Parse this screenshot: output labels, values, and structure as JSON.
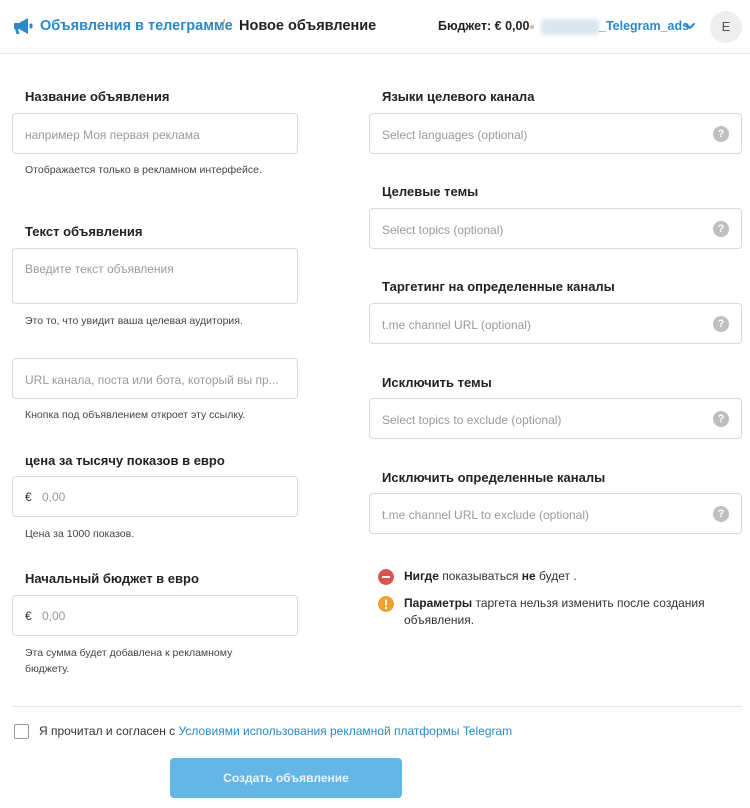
{
  "header": {
    "section_link": "Объявления в телеграмме",
    "separator": "/",
    "current_page": "Новое объявление",
    "budget": "Бюджет: € 0,00",
    "account_name": "_Telegram_ads",
    "avatar_letter": "E",
    "logo_icon": "megaphone-icon",
    "accent_color": "#2b8ac6"
  },
  "left": {
    "ad_name_label": "Название объявления",
    "ad_name_placeholder": "например Моя первая реклама",
    "ad_name_hint": "Отображается только в рекламном интерфейсе.",
    "ad_text_label": "Текст объявления",
    "ad_text_placeholder": "Введите текст объявления",
    "ad_text_hint": "Это то, что увидит ваша целевая аудитория.",
    "url_placeholder": "URL канала, поста или бота, который вы пр...",
    "url_hint": "Кнопка под объявлением откроет эту ссылку.",
    "cpm_label": "цена за тысячу показов в евро",
    "cpm_currency": "€",
    "cpm_value": "0,00",
    "cpm_hint": "Цена за 1000 показов.",
    "budget_label": "Начальный бюджет в евро",
    "budget_currency": "€",
    "budget_value": "0,00",
    "budget_hint": "Эта сумма будет добавлена к рекламному бюджету."
  },
  "right": {
    "languages_label": "Языки целевого канала",
    "languages_placeholder": "Select languages (optional)",
    "topics_label": "Целевые темы",
    "topics_placeholder": "Select topics (optional)",
    "channels_label": "Таргетинг на определенные каналы",
    "channels_placeholder": "t.me channel URL (optional)",
    "exclude_topics_label": "Исключить темы",
    "exclude_topics_placeholder": "Select topics to exclude (optional)",
    "exclude_channels_label": "Исключить определенные каналы",
    "exclude_channels_placeholder": "t.me channel URL to exclude (optional)",
    "help_glyph": "?",
    "help_icon": "help-circle-icon"
  },
  "notes": {
    "nowhere_bold": "Нигде",
    "nowhere_mid": " показываться ",
    "nowhere_bold2": "не",
    "nowhere_end": " будет .",
    "nowhere_color": "#d9534f",
    "params_bold": "Параметры",
    "params_rest": " таргета нельзя изменить после создания объявления.",
    "params_color": "#f0a030"
  },
  "footer": {
    "agree_prefix": "Я прочитал и согласен с ",
    "agree_link": "Условиями использования рекламной платформы Telegram",
    "create_button": "Создать объявление",
    "button_color": "#63b6e6"
  }
}
